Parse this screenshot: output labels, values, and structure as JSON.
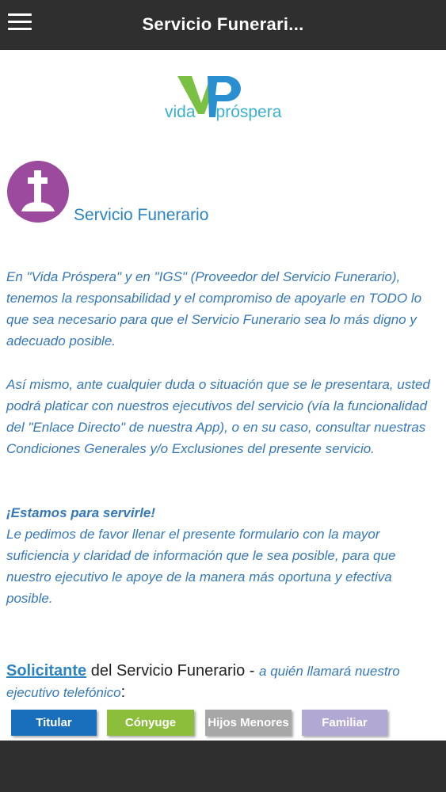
{
  "header": {
    "title": "Servicio Funerari..."
  },
  "logo": {
    "word1": "vida",
    "word2": "próspera"
  },
  "section": {
    "title": "Servicio Funerario"
  },
  "paragraphs": {
    "p1": "En \"Vida Próspera\" y en \"IGS\" (Proveedor del Servicio Funerario), tenemos la responsabilidad y el compromiso de apoyarle en TODO lo que sea necesario para que el Servicio Funerario sea lo más digno y adecuado posible.",
    "p2": "Así mismo, ante cualquier duda o situación que se le presentara, usted podrá platicar con nuestros ejecutivos del servicio (vía la funcionalidad del \"Enlace Directo\" de nuestra App), o en su caso, consultar nuestras Condiciones Generales y/o Exclusiones del presente servicio.",
    "p3_head": "¡Estamos para servirle!",
    "p3": "Le pedimos de favor llenar el presente formulario con la mayor suficiencia y claridad de información que le sea posible, para que nuestro ejecutivo le apoye de la manera más oportuna y efectiva posible."
  },
  "solicitante": {
    "link": "Solicitante",
    "rest": " del Servicio Funerario - ",
    "italic": "a quién llamará nuestro ejecutivo telefónico",
    "colon": ":"
  },
  "buttons": [
    {
      "label": "Titular",
      "color": "#1a6fbd"
    },
    {
      "label": "Cónyuge",
      "color": "#8cbe3c"
    },
    {
      "label": "Hijos Menores",
      "color": "#a7a7a7"
    },
    {
      "label": "Familiar",
      "color": "#b1a8d4"
    }
  ],
  "colors": {
    "topbar": "#2f2f2f",
    "logo_green": "#7ac143",
    "logo_blue": "#2a8fd0",
    "icon_purple": "#9b4a9e",
    "text_blue": "#3578b8"
  }
}
